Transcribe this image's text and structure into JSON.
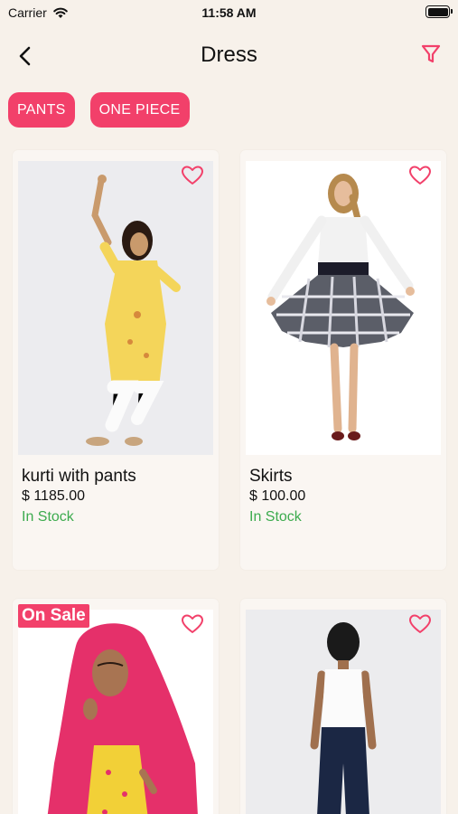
{
  "status_bar": {
    "carrier": "Carrier",
    "time": "11:58 AM"
  },
  "nav": {
    "title": "Dress"
  },
  "chips": [
    "PANTS",
    "ONE PIECE"
  ],
  "products": [
    {
      "name": "kurti with pants",
      "price": "$ 1185.00",
      "stock": "In Stock",
      "badge": ""
    },
    {
      "name": "Skirts",
      "price": "$ 100.00",
      "stock": "In Stock",
      "badge": ""
    },
    {
      "name": "",
      "price": "",
      "stock": "",
      "badge": "On Sale"
    },
    {
      "name": "",
      "price": "",
      "stock": "",
      "badge": ""
    }
  ],
  "colors": {
    "accent": "#f2406a",
    "in_stock": "#3cab4e",
    "background": "#f7f1ea"
  }
}
